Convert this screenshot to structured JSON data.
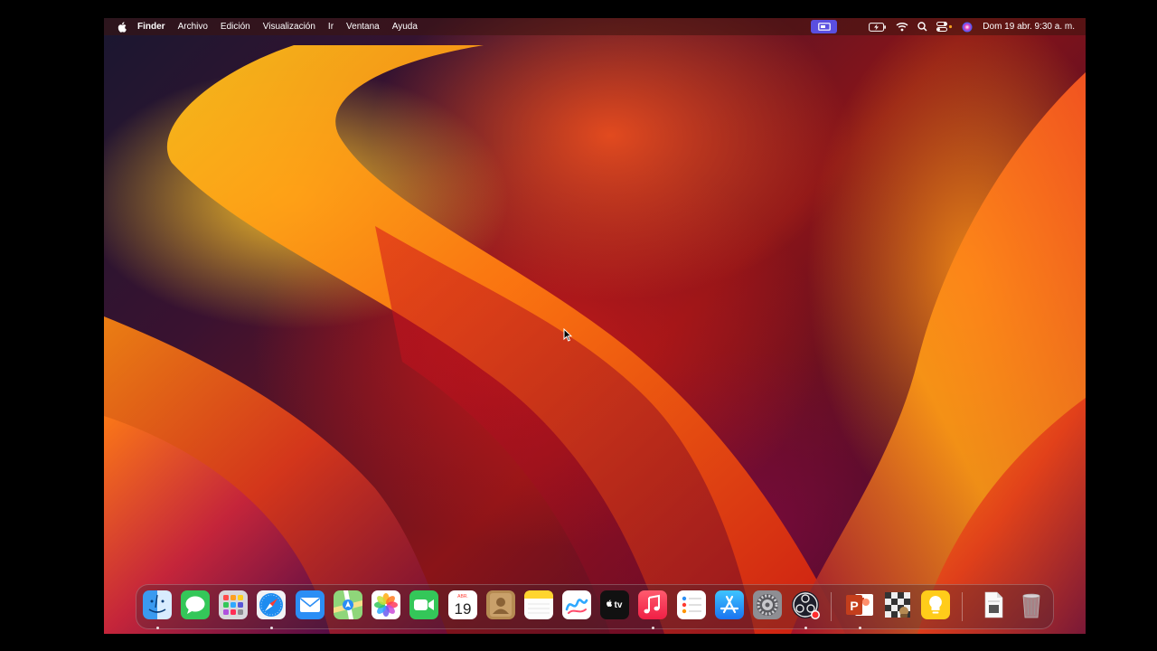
{
  "menubar": {
    "apple_icon": "apple-logo-icon",
    "app_name": "Finder",
    "items": [
      "Archivo",
      "Edición",
      "Visualización",
      "Ir",
      "Ventana",
      "Ayuda"
    ],
    "status_icons": [
      "screen-share-icon",
      "battery-charging-icon",
      "wifi-icon",
      "spotlight-search-icon",
      "control-center-icon",
      "siri-icon"
    ],
    "clock": "Dom 19 abr.  9:30 a. m."
  },
  "dock": {
    "apps": [
      {
        "name": "Finder",
        "icon": "finder-icon",
        "running": true
      },
      {
        "name": "Mensajes",
        "icon": "messages-icon",
        "running": false
      },
      {
        "name": "Launchpad",
        "icon": "launchpad-icon",
        "running": false
      },
      {
        "name": "Safari",
        "icon": "safari-icon",
        "running": true
      },
      {
        "name": "Mail",
        "icon": "mail-icon",
        "running": false
      },
      {
        "name": "Mapas",
        "icon": "maps-icon",
        "running": false
      },
      {
        "name": "Fotos",
        "icon": "photos-icon",
        "running": false
      },
      {
        "name": "FaceTime",
        "icon": "facetime-icon",
        "running": false
      },
      {
        "name": "Calendario",
        "icon": "calendar-icon",
        "running": false
      },
      {
        "name": "Contactos",
        "icon": "contacts-icon",
        "running": false
      },
      {
        "name": "Notas",
        "icon": "notes-icon",
        "running": false
      },
      {
        "name": "Freeform",
        "icon": "freeform-icon",
        "running": false
      },
      {
        "name": "TV",
        "icon": "apple-tv-icon",
        "running": false
      },
      {
        "name": "Música",
        "icon": "music-icon",
        "running": true
      },
      {
        "name": "Recordatorios",
        "icon": "reminders-icon",
        "running": false
      },
      {
        "name": "App Store",
        "icon": "app-store-icon",
        "running": false
      },
      {
        "name": "Configuración del Sistema",
        "icon": "system-settings-icon",
        "running": false
      },
      {
        "name": "OBS",
        "icon": "obs-icon",
        "running": true
      }
    ],
    "recent_apps": [
      {
        "name": "PowerPoint",
        "icon": "powerpoint-icon",
        "running": true
      },
      {
        "name": "Ajedrez",
        "icon": "chess-icon",
        "running": false
      },
      {
        "name": "Sugerencias",
        "icon": "tips-icon",
        "running": false
      }
    ],
    "stack_items": [
      {
        "name": "Documento",
        "icon": "document-icon"
      },
      {
        "name": "Papelera",
        "icon": "trash-icon"
      }
    ],
    "calendar_month": "ABR.",
    "calendar_day": "19",
    "tv_label": "tv",
    "powerpoint_letter": "P"
  },
  "colors": {
    "screen_share_badge": "#5a4fe0",
    "menubar_bg": "#3c140f"
  }
}
